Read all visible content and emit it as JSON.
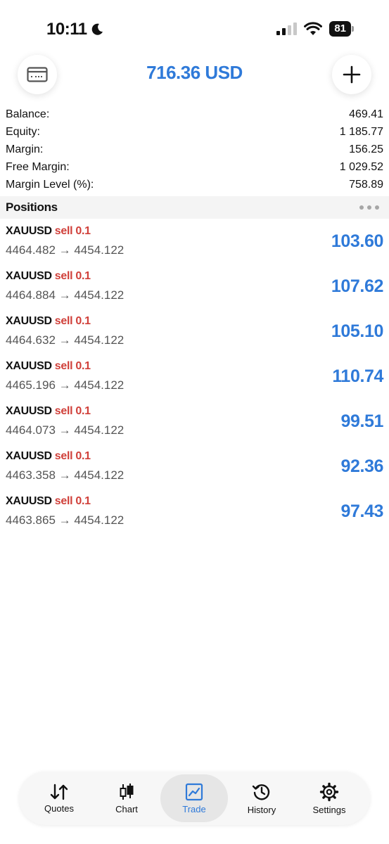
{
  "status_bar": {
    "time": "10:11",
    "battery": "81"
  },
  "header": {
    "title": "716.36 USD"
  },
  "summary": [
    {
      "label": "Balance:",
      "value": "469.41"
    },
    {
      "label": "Equity:",
      "value": "1 185.77"
    },
    {
      "label": "Margin:",
      "value": "156.25"
    },
    {
      "label": "Free Margin:",
      "value": "1 029.52"
    },
    {
      "label": "Margin Level (%):",
      "value": "758.89"
    }
  ],
  "positions": {
    "title": "Positions",
    "items": [
      {
        "symbol": "XAUUSD",
        "side": "sell 0.1",
        "prices": "4464.482 → 4454.122",
        "profit": "103.60"
      },
      {
        "symbol": "XAUUSD",
        "side": "sell 0.1",
        "prices": "4464.884 → 4454.122",
        "profit": "107.62"
      },
      {
        "symbol": "XAUUSD",
        "side": "sell 0.1",
        "prices": "4464.632 → 4454.122",
        "profit": "105.10"
      },
      {
        "symbol": "XAUUSD",
        "side": "sell 0.1",
        "prices": "4465.196 → 4454.122",
        "profit": "110.74"
      },
      {
        "symbol": "XAUUSD",
        "side": "sell 0.1",
        "prices": "4464.073 → 4454.122",
        "profit": "99.51"
      },
      {
        "symbol": "XAUUSD",
        "side": "sell 0.1",
        "prices": "4463.358 → 4454.122",
        "profit": "92.36"
      },
      {
        "symbol": "XAUUSD",
        "side": "sell 0.1",
        "prices": "4463.865 → 4454.122",
        "profit": "97.43"
      }
    ]
  },
  "tabs": [
    {
      "label": "Quotes",
      "icon": "quotes-arrows-icon"
    },
    {
      "label": "Chart",
      "icon": "candlestick-icon"
    },
    {
      "label": "Trade",
      "icon": "trade-chart-icon",
      "active": true
    },
    {
      "label": "History",
      "icon": "history-clock-icon"
    },
    {
      "label": "Settings",
      "icon": "gear-icon"
    }
  ],
  "colors": {
    "accent": "#2f7ad9",
    "sell": "#d0403a",
    "muted": "#555555"
  }
}
